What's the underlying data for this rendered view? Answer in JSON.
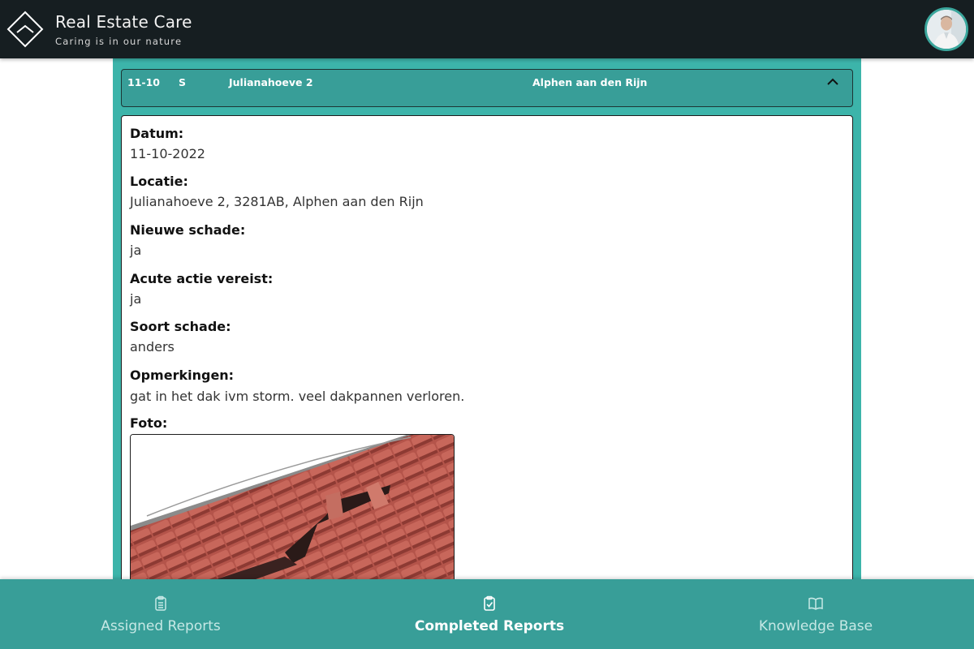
{
  "app": {
    "title": "Real Estate Care",
    "tagline": "Caring is in our nature"
  },
  "report": {
    "header": {
      "date_short": "11-10",
      "type_code": "S",
      "street": "Julianahoeve 2",
      "city": "Alphen aan den Rijn",
      "toggle_icon": "chevron-up-icon"
    },
    "fields": [
      {
        "label": "Datum:",
        "value": "11-10-2022"
      },
      {
        "label": "Locatie:",
        "value": "Julianahoeve 2, 3281AB, Alphen aan den Rijn"
      },
      {
        "label": "Nieuwe schade:",
        "value": "ja"
      },
      {
        "label": "Acute actie vereist:",
        "value": "ja"
      },
      {
        "label": "Soort schade:",
        "value": "anders"
      },
      {
        "label": "Opmerkingen:",
        "value": "gat in het dak ivm storm. veel dakpannen verloren."
      }
    ],
    "photo_label": "Foto:"
  },
  "bottom_nav": {
    "items": [
      {
        "label": "Assigned Reports",
        "icon": "clipboard-list-icon",
        "active": false
      },
      {
        "label": "Completed Reports",
        "icon": "clipboard-check-icon",
        "active": true
      },
      {
        "label": "Knowledge Base",
        "icon": "book-open-icon",
        "active": false
      }
    ]
  },
  "colors": {
    "header_bg": "#161e21",
    "panel_bg": "#3cb4aa",
    "nav_bg": "#389e98",
    "accent": "#3aa69c"
  }
}
